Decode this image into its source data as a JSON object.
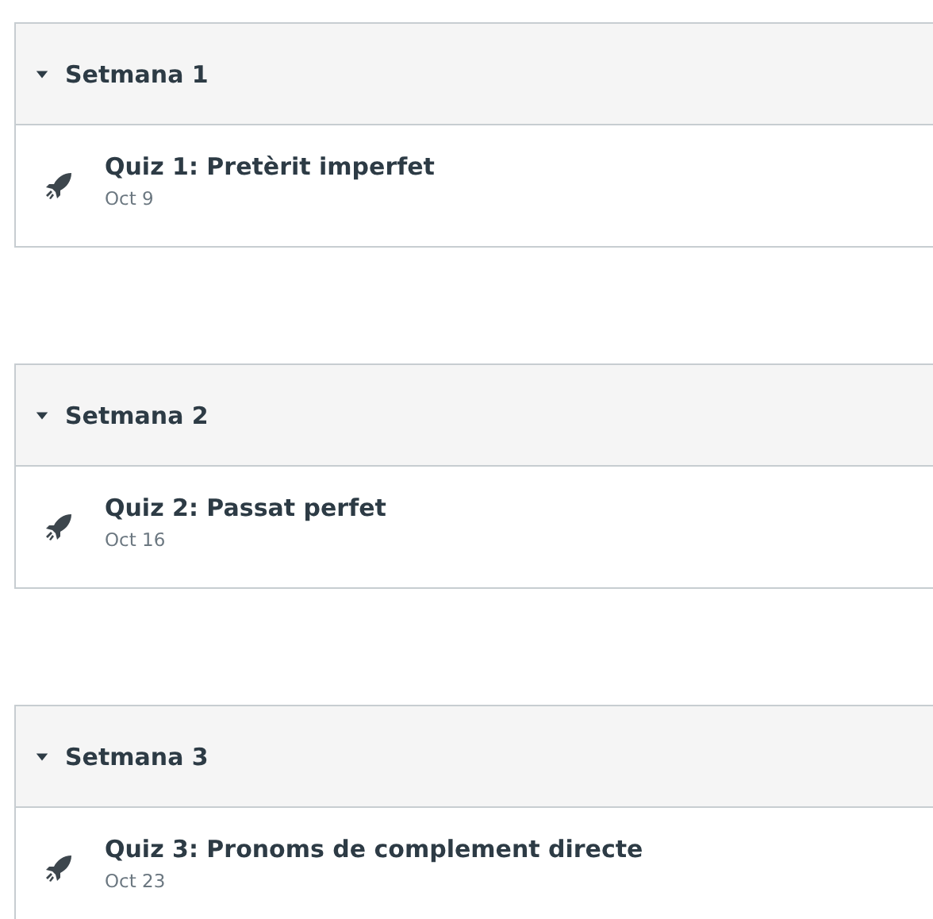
{
  "modules": [
    {
      "title": "Setmana 1",
      "expanded": true,
      "items": [
        {
          "kind": "quiz",
          "title": "Quiz 1: Pretèrit imperfet",
          "date": "Oct 9"
        }
      ]
    },
    {
      "title": "Setmana 2",
      "expanded": true,
      "items": [
        {
          "kind": "quiz",
          "title": "Quiz 2: Passat perfet",
          "date": "Oct 16"
        }
      ]
    },
    {
      "title": "Setmana 3",
      "expanded": true,
      "items": [
        {
          "kind": "quiz",
          "title": "Quiz 3: Pronoms de complement directe",
          "date": "Oct 23"
        }
      ]
    }
  ]
}
